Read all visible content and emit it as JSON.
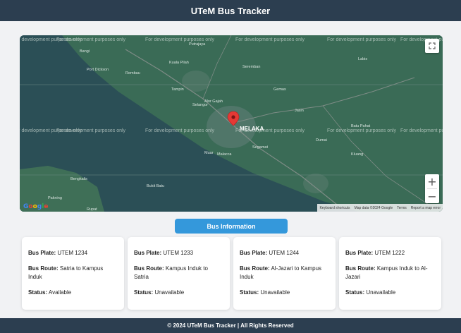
{
  "header": {
    "title": "UTeM Bus Tracker"
  },
  "map": {
    "watermark": "For development purposes only",
    "city_label": "MELAKA",
    "places": [
      "Bangi",
      "Putrajaya",
      "Kuala Pilah",
      "Seremban",
      "Port Dickson",
      "Rembau",
      "Tampin",
      "Gemas",
      "Alor Gajah",
      "Jasin",
      "Malacca",
      "Muar",
      "Batu Pahat",
      "Segamat",
      "Dumai",
      "Bengkalis",
      "Rupat",
      "Pakning",
      "Bukit Batu",
      "Selangor",
      "Labis",
      "Kluang"
    ],
    "google_logo": "Google",
    "attribution": {
      "shortcuts": "Keyboard shortcuts",
      "data": "Map data ©2024 Google",
      "terms": "Terms",
      "report": "Report a map error"
    },
    "zoom_in": "+",
    "zoom_out": "−",
    "colors": {
      "land": "#3a6b56",
      "sea": "#2b4f56",
      "marker": "#e53935"
    }
  },
  "bus_info_button": "Bus Information",
  "buses": [
    {
      "plate_label": "Bus Plate:",
      "plate": "UTEM 1234",
      "route_label": "Bus Route:",
      "route": "Satria to Kampus Induk",
      "status_label": "Status:",
      "status": "Available"
    },
    {
      "plate_label": "Bus Plate:",
      "plate": "UTEM 1233",
      "route_label": "Bus Route:",
      "route": "Kampus Induk to Satria",
      "status_label": "Status:",
      "status": "Unavailable"
    },
    {
      "plate_label": "Bus Plate:",
      "plate": "UTEM 1244",
      "route_label": "Bus Route:",
      "route": "Al-Jazari to Kampus Induk",
      "status_label": "Status:",
      "status": "Unavailable"
    },
    {
      "plate_label": "Bus Plate:",
      "plate": "UTEM 1222",
      "route_label": "Bus Route:",
      "route": "Kampus Induk to Al-Jazari",
      "status_label": "Status:",
      "status": "Unavailable"
    }
  ],
  "footer": "© 2024 UTeM Bus Tracker | All Rights Reserved"
}
